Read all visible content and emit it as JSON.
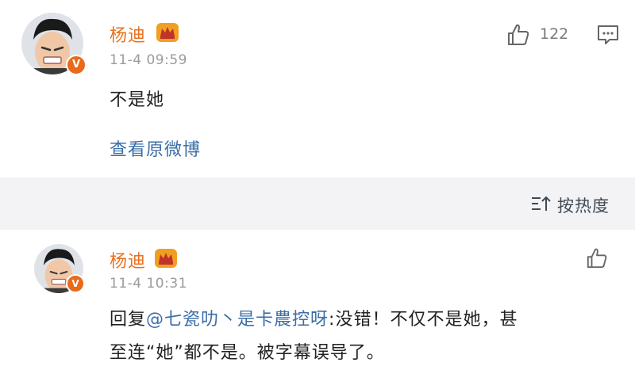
{
  "comment": {
    "author": "杨迪",
    "time": "11-4 09:59",
    "text": "不是她",
    "view_original": "查看原微博",
    "like_count": "122"
  },
  "sort": {
    "label": "按热度"
  },
  "reply": {
    "author": "杨迪",
    "time": "11-4 10:31",
    "prefix": "回复",
    "mention": "@七瓷叻丶是卡農控呀",
    "line1_rest": ":没错！不仅不是她，甚",
    "line2": "至连“她”都不是。被字幕误导了。"
  },
  "badge": {
    "letter": "V"
  },
  "colors": {
    "name": "#e8711f",
    "link": "#3b6ea7",
    "badge": "#e86a1a",
    "separator": "#f3f3f5"
  }
}
